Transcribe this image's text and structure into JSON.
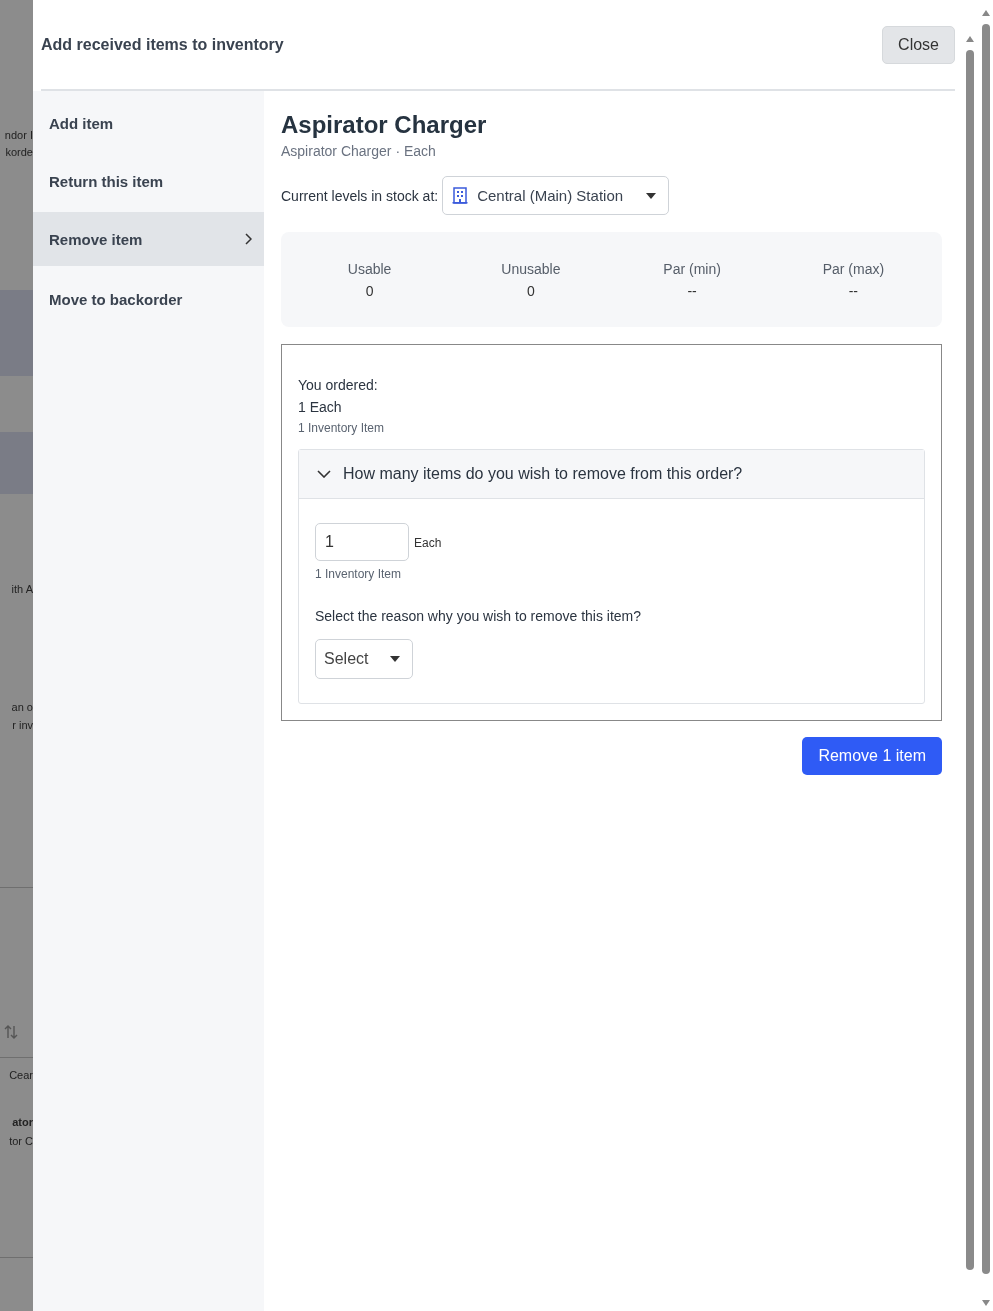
{
  "backdrop": {
    "fragments": [
      {
        "text": "ndor I",
        "bold": false
      },
      {
        "text": "korde",
        "bold": false
      },
      {
        "text": "ith A",
        "bold": false
      },
      {
        "text": "an o",
        "bold": false
      },
      {
        "text": "r inv",
        "bold": false
      },
      {
        "text": "Cear",
        "bold": false
      },
      {
        "text": "ator",
        "bold": true
      },
      {
        "text": "tor C",
        "bold": false
      }
    ]
  },
  "modal": {
    "title": "Add received items to inventory",
    "close_button": "Close",
    "sidebar": {
      "items": [
        {
          "label": "Add item",
          "selected": false
        },
        {
          "label": "Return this item",
          "selected": false
        },
        {
          "label": "Remove item",
          "selected": true
        },
        {
          "label": "Move to backorder",
          "selected": false
        }
      ]
    },
    "item": {
      "name": "Aspirator Charger",
      "subtitle": "Aspirator Charger · Each",
      "location_label": "Current levels in stock at:",
      "location": "Central (Main) Station"
    },
    "stock": [
      {
        "label": "Usable",
        "value": "0"
      },
      {
        "label": "Unusable",
        "value": "0"
      },
      {
        "label": "Par (min)",
        "value": "--"
      },
      {
        "label": "Par (max)",
        "value": "--"
      }
    ],
    "order": {
      "heading": "You ordered:",
      "quantity": "1 Each",
      "inventory": "1 Inventory Item",
      "panel": {
        "title": "How many items do you wish to remove from this order?",
        "expanded": true,
        "quantity_value": "1",
        "unit": "Each",
        "inventory": "1 Inventory Item",
        "reason_label": "Select the reason why you wish to remove this item?",
        "reason_select": "Select"
      }
    },
    "submit_button": "Remove 1 item"
  }
}
